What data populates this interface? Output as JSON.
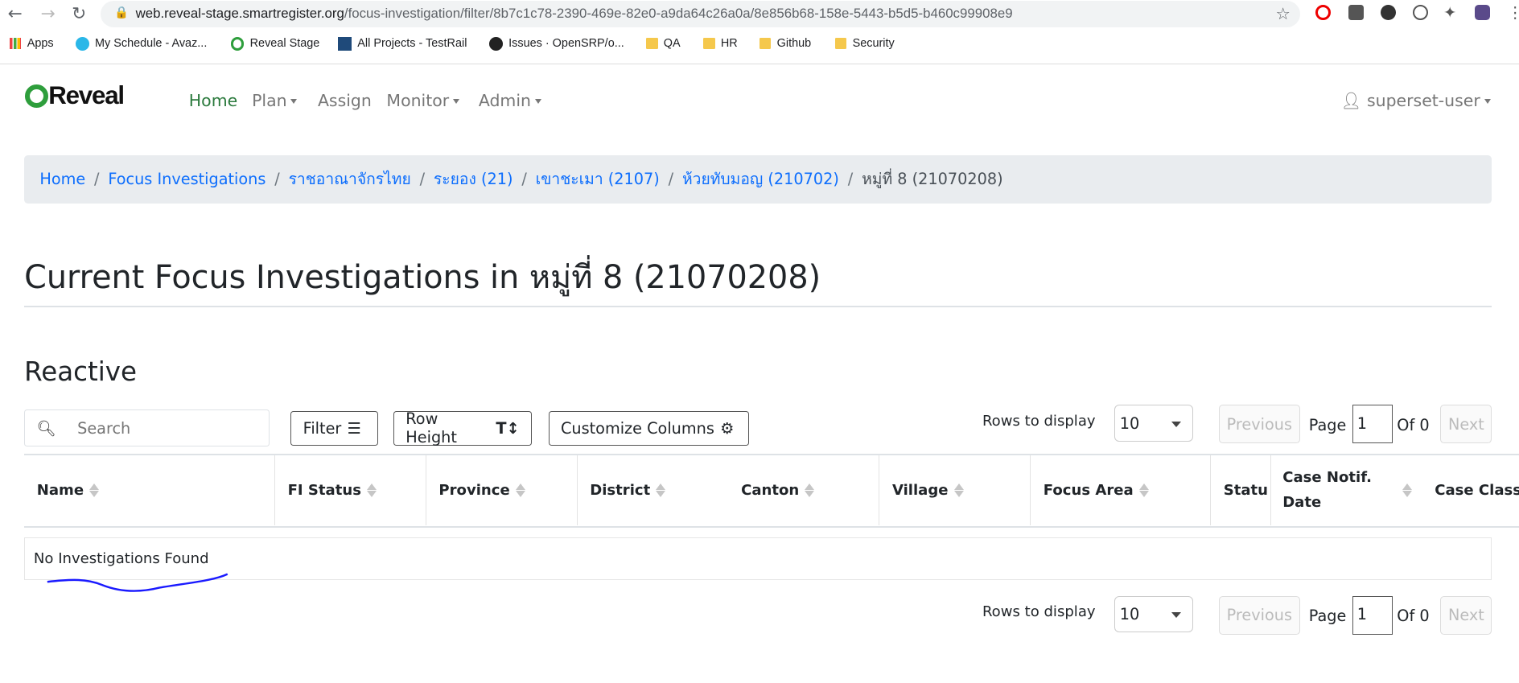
{
  "browser": {
    "url_host": "web.reveal-stage.smartregister.org",
    "url_path": "/focus-investigation/filter/8b7c1c78-2390-469e-82e0-a9da64c26a0a/8e856b68-158e-5443-b5d5-b460c99908e9",
    "bookmarks": [
      "Apps",
      "My Schedule - Avaz...",
      "Reveal Stage",
      "All Projects - TestRail",
      "Issues · OpenSRP/o...",
      "QA",
      "HR",
      "Github",
      "Security"
    ]
  },
  "nav": {
    "logo": "Reveal",
    "items": [
      "Home",
      "Plan",
      "Assign",
      "Monitor",
      "Admin"
    ],
    "user": "superset-user"
  },
  "breadcrumb": [
    "Home",
    "Focus Investigations",
    "ราชอาณาจักรไทย",
    "ระยอง (21)",
    "เขาชะเมา (2107)",
    "ห้วยทับมอญ (210702)",
    "หมู่ที่ 8 (21070208)"
  ],
  "page_title": "Current Focus Investigations in หมู่ที่ 8 (21070208)",
  "section_title": "Reactive",
  "toolbar": {
    "search_placeholder": "Search",
    "filter": "Filter",
    "row_height": "Row Height",
    "customize": "Customize Columns"
  },
  "pagination": {
    "rows_label": "Rows to display",
    "rows_value": "10",
    "previous": "Previous",
    "page_label": "Page",
    "page_value": "1",
    "of_label": "Of 0",
    "next": "Next"
  },
  "table": {
    "columns": [
      "Name",
      "FI Status",
      "Province",
      "District",
      "Canton",
      "Village",
      "Focus Area",
      "Statu",
      "Case Notif. Date",
      "Case Class"
    ],
    "empty": "No Investigations Found"
  },
  "colors": {
    "accent": "#0d6efd",
    "brand": "#2e9e3c",
    "annotation": "#1a1aff"
  }
}
